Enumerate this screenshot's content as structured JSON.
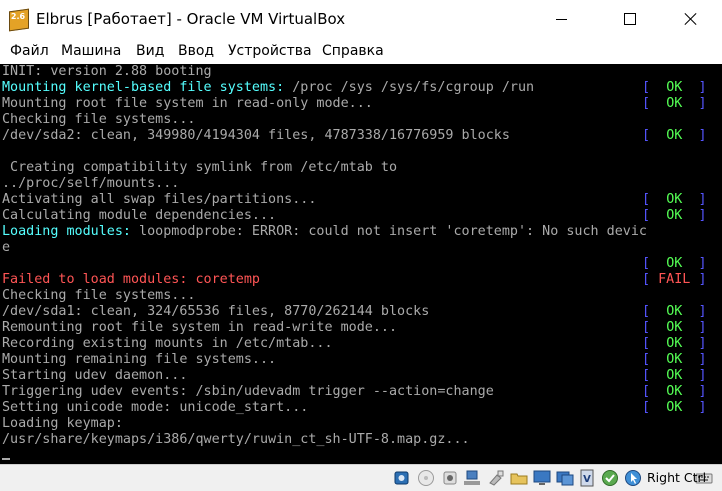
{
  "window": {
    "title": "Elbrus [Работает] - Oracle VM VirtualBox",
    "app_icon_version": "2.6",
    "controls": [
      "minimize",
      "maximize",
      "close"
    ]
  },
  "menu": {
    "items": [
      "Файл",
      "Машина",
      "Вид",
      "Ввод",
      "Устройства",
      "Справка"
    ]
  },
  "console": {
    "colors": {
      "background": "#000000",
      "text": "#aaaaaa",
      "highlight": "#55ffff",
      "error": "#ff5555",
      "ok": "#55ff55",
      "bracket": "#5555ff"
    },
    "status_texts": {
      "ok": "OK",
      "fail": "FAIL"
    },
    "lines": [
      {
        "prefix": "",
        "text": "INIT: version 2.88 booting"
      },
      {
        "prefix": "Mounting kernel-based file systems:",
        "text": " /proc /sys /sys/fs/cgroup /run",
        "status": "ok"
      },
      {
        "prefix": "",
        "text": "Mounting root file system in read-only mode...",
        "status": "ok"
      },
      {
        "prefix": "",
        "text": "Checking file systems..."
      },
      {
        "prefix": "",
        "text": "/dev/sda2: clean, 349980/4194304 files, 4787338/16776959 blocks",
        "status": "ok"
      },
      {
        "prefix": "",
        "text": ""
      },
      {
        "prefix": "",
        "text": " Creating compatibility symlink from /etc/mtab to"
      },
      {
        "prefix": "",
        "text": "../proc/self/mounts..."
      },
      {
        "prefix": "",
        "text": "Activating all swap files/partitions...",
        "status": "ok"
      },
      {
        "prefix": "",
        "text": "Calculating module dependencies...",
        "status": "ok"
      },
      {
        "prefix": "Loading modules:",
        "text": " loopmodprobe: ERROR: could not insert 'coretemp': No such devic"
      },
      {
        "prefix": "",
        "text": "e"
      },
      {
        "prefix": "",
        "text": "",
        "status": "ok"
      },
      {
        "prefix": "",
        "text": "Failed to load modules: coretemp",
        "error": true,
        "status": "fail"
      },
      {
        "prefix": "",
        "text": "Checking file systems..."
      },
      {
        "prefix": "",
        "text": "/dev/sda1: clean, 324/65536 files, 8770/262144 blocks",
        "status": "ok"
      },
      {
        "prefix": "",
        "text": "Remounting root file system in read-write mode...",
        "status": "ok"
      },
      {
        "prefix": "",
        "text": "Recording existing mounts in /etc/mtab...",
        "status": "ok"
      },
      {
        "prefix": "",
        "text": "Mounting remaining file systems...",
        "status": "ok"
      },
      {
        "prefix": "",
        "text": "Starting udev daemon...",
        "status": "ok"
      },
      {
        "prefix": "",
        "text": "Triggering udev events: /sbin/udevadm trigger --action=change",
        "status": "ok"
      },
      {
        "prefix": "",
        "text": "Setting unicode mode: unicode_start...",
        "status": "ok"
      },
      {
        "prefix": "",
        "text": "Loading keymap:"
      },
      {
        "prefix": "",
        "text": "/usr/share/keymaps/i386/qwerty/ruwin_ct_sh-UTF-8.map.gz..."
      }
    ]
  },
  "statusbar": {
    "icons": [
      "hard-disk-icon",
      "optical-drive-icon",
      "audio-icon",
      "network-icon",
      "usb-icon",
      "shared-folders-icon",
      "display-icon",
      "video-capture-icon",
      "virtualization-icon",
      "guest-additions-icon",
      "mouse-integration-icon",
      "keyboard-icon"
    ],
    "host_key": "Right Ctrl"
  }
}
